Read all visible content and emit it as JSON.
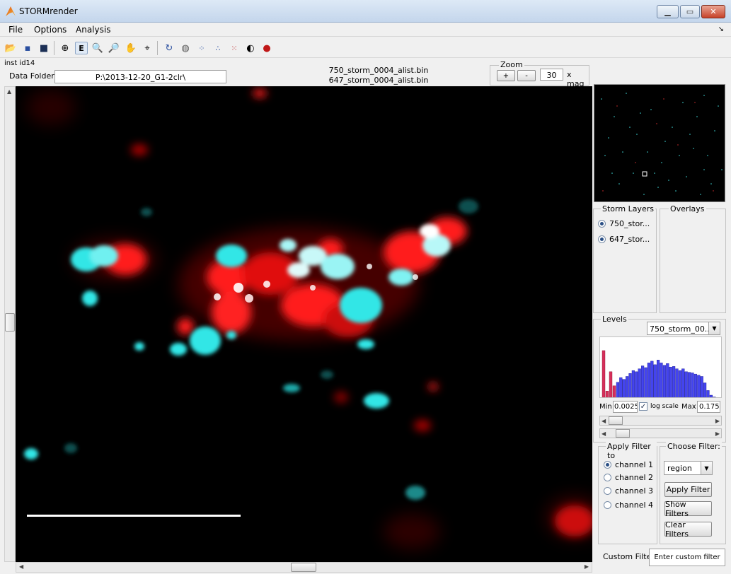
{
  "window": {
    "title": "STORMrender"
  },
  "menu": [
    "File",
    "Options",
    "Analysis"
  ],
  "info": {
    "inst_id": "inst id14"
  },
  "data_folder": {
    "label": "Data Folder",
    "value": "P:\\2013-12-20_G1-2clr\\"
  },
  "files": [
    "750_storm_0004_alist.bin",
    "647_storm_0004_alist.bin"
  ],
  "zoom": {
    "title": "Zoom",
    "plus": "+",
    "minus": "-",
    "value": "30",
    "unit": "x mag"
  },
  "storm_layers": {
    "title": "Storm Layers",
    "items": [
      {
        "label": "750_stor...",
        "checked": true
      },
      {
        "label": "647_stor...",
        "checked": true
      }
    ]
  },
  "overlays": {
    "title": "Overlays"
  },
  "levels": {
    "title": "Levels",
    "selected_layer": "750_storm_00...",
    "min_label": "Min",
    "min_value": "0.0025",
    "log_scale_label": "log scale",
    "log_scale_checked": true,
    "max_label": "Max",
    "max_value": "0.175",
    "histogram": {
      "red": [
        0.82,
        0.13,
        0.46,
        0.22
      ],
      "blue": [
        0.28,
        0.36,
        0.33,
        0.38,
        0.43,
        0.48,
        0.46,
        0.51,
        0.56,
        0.53,
        0.61,
        0.64,
        0.58,
        0.66,
        0.61,
        0.57,
        0.6,
        0.54,
        0.55,
        0.51,
        0.48,
        0.51,
        0.46,
        0.45,
        0.44,
        0.42,
        0.4,
        0.38,
        0.27,
        0.14,
        0.06,
        0.03
      ]
    }
  },
  "filter": {
    "apply_title": "Apply Filter to",
    "channels": [
      {
        "label": "channel 1",
        "checked": true
      },
      {
        "label": "channel 2",
        "checked": false
      },
      {
        "label": "channel 3",
        "checked": false
      },
      {
        "label": "channel 4",
        "checked": false
      }
    ],
    "choose_title": "Choose Filter:",
    "choice": "region",
    "apply_button": "Apply Filter",
    "show_button": "Show Filters",
    "clear_button": "Clear Filters"
  },
  "custom_filter": {
    "label": "Custom Filter",
    "placeholder": "Enter custom filter"
  },
  "colors": {
    "channel_red": "#ff1a1a",
    "channel_cyan": "#33e6e6",
    "hist_red": "#d62f5a",
    "hist_blue": "#4444ee"
  }
}
